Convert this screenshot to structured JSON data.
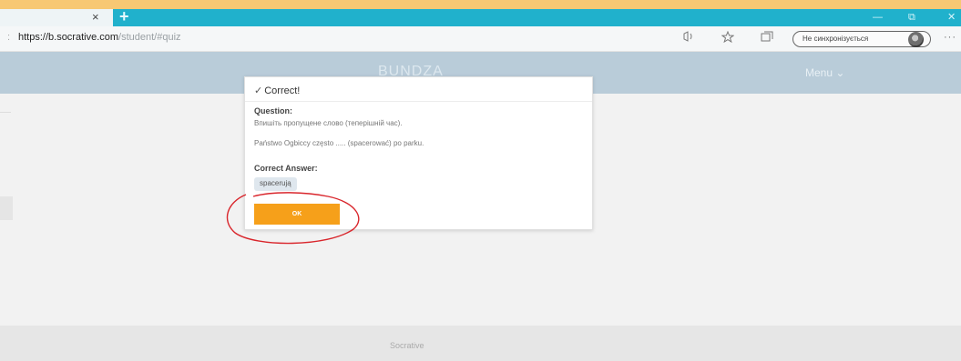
{
  "browser": {
    "tab_close": "×",
    "new_tab": "+",
    "window_controls": [
      "—",
      "⧉",
      "✕"
    ],
    "url_host": "https://b.socrative.com",
    "url_path": "/student/#quiz",
    "profile_label": "Не синхронізується",
    "more": "···",
    "icons": [
      "read-aloud-icon",
      "favorite-icon",
      "collections-icon"
    ]
  },
  "header": {
    "brand": "BUNDZA",
    "menu": "Menu ⌄"
  },
  "dialog": {
    "status": "Correct!",
    "question_label": "Question:",
    "question_text": "Впишіть пропущене слово (теперішній час).",
    "question_sentence": "Państwo Ogbiccy często ..... (spacerować) po parku.",
    "answer_label": "Correct Answer:",
    "answer": "spacerują",
    "ok_label": "OK"
  },
  "footer": {
    "text": "Socrative"
  },
  "colors": {
    "accent": "#f6a01a",
    "tabbar": "#20b1cc",
    "header": "#b9ccd9",
    "annotation": "#d9262c"
  }
}
